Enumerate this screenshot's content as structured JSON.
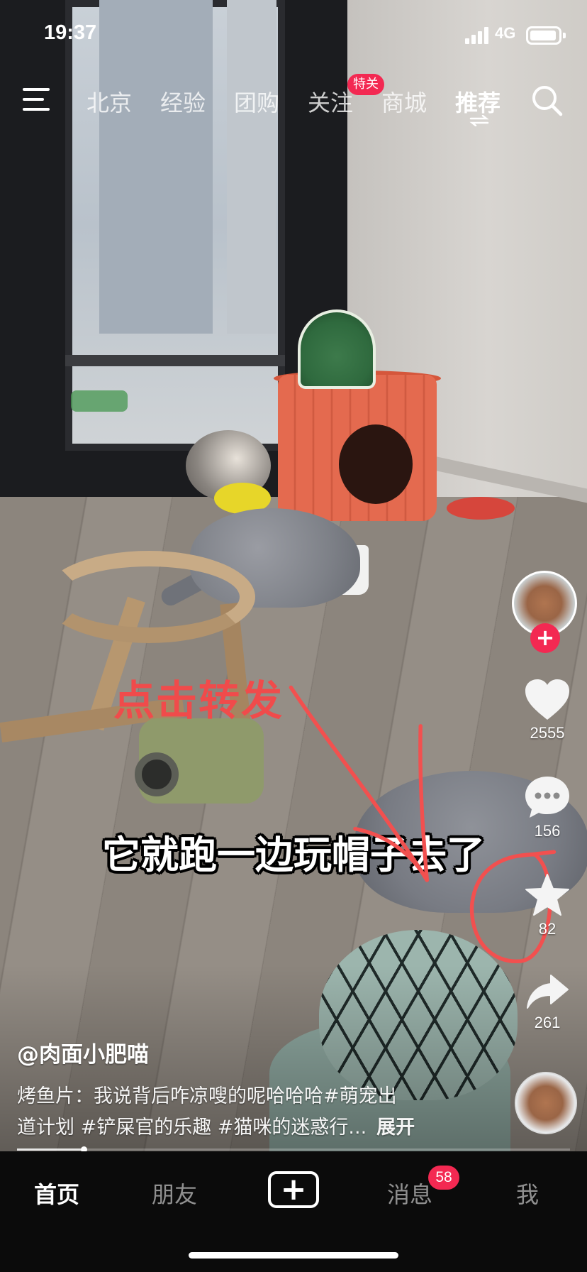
{
  "status_bar": {
    "time": "19:37",
    "network": "4G"
  },
  "top_nav": {
    "tabs": [
      {
        "label": "北京",
        "active": false
      },
      {
        "label": "经验",
        "active": false
      },
      {
        "label": "团购",
        "active": false
      },
      {
        "label": "关注",
        "active": false
      },
      {
        "label": "商城",
        "active": false
      },
      {
        "label": "推荐",
        "active": true
      }
    ],
    "follow_badge": "特关",
    "icons": [
      "menu-icon",
      "search-icon",
      "switch-arrows-icon"
    ]
  },
  "actions": {
    "likes": "2555",
    "comments": "156",
    "favorites": "82",
    "shares": "261",
    "icons": [
      "heart-icon",
      "comment-icon",
      "star-icon",
      "share-icon",
      "plus-icon"
    ]
  },
  "overlay": {
    "annotation": "点击转发",
    "subtitle": "它就跑一边玩帽子去了"
  },
  "caption": {
    "author": "@肉面小肥喵",
    "line1": "烤鱼片：我说背后咋凉嗖的呢哈哈哈#萌宠出",
    "line2": "道计划 #铲屎官的乐趣 #猫咪的迷惑行...",
    "expand": "展开"
  },
  "video_progress": 0.12,
  "bottom_tabs": {
    "home": "首页",
    "friends": "朋友",
    "create": "+",
    "messages": "消息",
    "messages_badge": "58",
    "me": "我"
  },
  "colors": {
    "accent": "#f32952",
    "annotation": "#f04b4b",
    "bar": "#0b0b0b"
  }
}
